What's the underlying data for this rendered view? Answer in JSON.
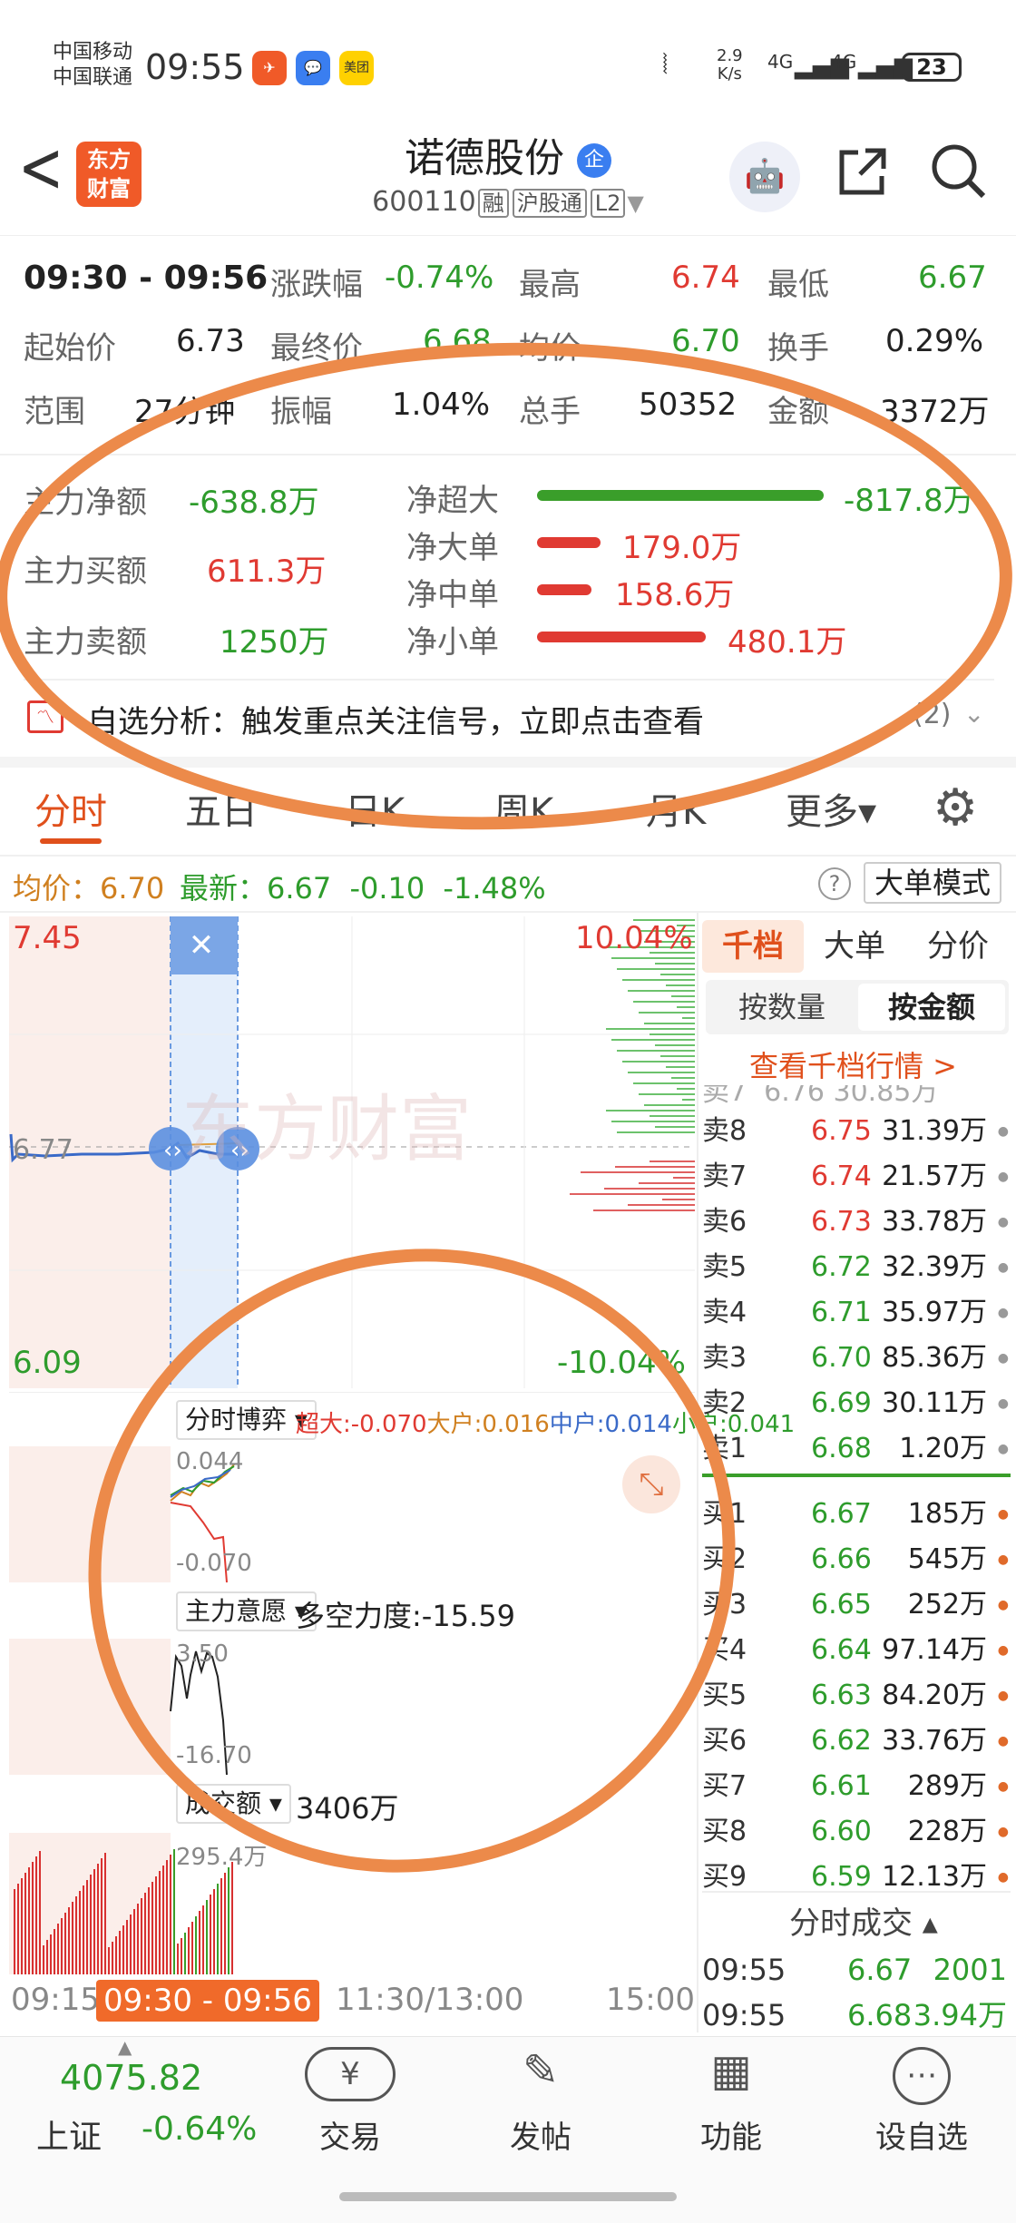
{
  "status": {
    "carrier1": "中国移动",
    "carrier2": "中国联通",
    "time": "09:55",
    "apps": [
      "✈",
      "💬",
      "美团"
    ],
    "net_speed": "2.9\nK/s",
    "sig1": "4G",
    "sig2": "4G",
    "battery": "23"
  },
  "header": {
    "back": "<",
    "logo": "东方\n财富",
    "title": "诺德股份",
    "badge": "企",
    "code": "600110",
    "tags": [
      "融",
      "沪股通",
      "L2"
    ]
  },
  "quote": {
    "time_range": "09:30 - 09:56",
    "row1": [
      {
        "label": "涨跌幅",
        "value": "-0.74%",
        "color": "#2e9c2c"
      },
      {
        "label": "最高",
        "value": "6.74",
        "color": "#e03a32"
      },
      {
        "label": "最低",
        "value": "6.67",
        "color": "#2e9c2c"
      }
    ],
    "row2": [
      {
        "label": "起始价",
        "value": "6.73",
        "color": "#222"
      },
      {
        "label": "最终价",
        "value": "6.68",
        "color": "#2e9c2c"
      },
      {
        "label": "均价",
        "value": "6.70",
        "color": "#2e9c2c"
      },
      {
        "label": "换手",
        "value": "0.29%",
        "color": "#222"
      }
    ],
    "row3": [
      {
        "label": "范围",
        "value": "27分钟",
        "color": "#222"
      },
      {
        "label": "振幅",
        "value": "1.04%",
        "color": "#222"
      },
      {
        "label": "总手",
        "value": "50352",
        "color": "#222"
      },
      {
        "label": "金额",
        "value": "3372万",
        "color": "#222"
      }
    ]
  },
  "fund_flow": {
    "left": [
      {
        "label": "主力净额",
        "value": "-638.8万",
        "color": "#2e9c2c"
      },
      {
        "label": "主力买额",
        "value": "611.3万",
        "color": "#e03a32"
      },
      {
        "label": "主力卖额",
        "value": "1250万",
        "color": "#2e9c2c"
      }
    ],
    "right": [
      {
        "label": "净超大",
        "value": "-817.8万",
        "color": "#2e9c2c",
        "fill": 1.0
      },
      {
        "label": "净大单",
        "value": "179.0万",
        "color": "#e03a32",
        "fill": 0.22
      },
      {
        "label": "净中单",
        "value": "158.6万",
        "color": "#e03a32",
        "fill": 0.19
      },
      {
        "label": "净小单",
        "value": "480.1万",
        "color": "#e03a32",
        "fill": 0.59
      }
    ],
    "alert": "自选分析：触发重点关注信号，立即点击查看",
    "alert_count": "(2)"
  },
  "tabs": [
    "分时",
    "五日",
    "日K",
    "周K",
    "月K",
    "更多▾"
  ],
  "chart_header": {
    "avg_label": "均价：6.70",
    "latest_label": "最新：",
    "latest": "6.67",
    "change": "-0.10",
    "change_pct": "-1.48%",
    "mode_button": "大单模式"
  },
  "chart": {
    "ymax": "7.45",
    "ymid": "6.77",
    "ymin": "6.09",
    "pct_top": "10.04%",
    "pct_bot": "-10.04%",
    "watermark": "东方财富",
    "close_x": "✕",
    "xt1": "09:15",
    "xt_sel": "09:30 - 09:56",
    "xt2": "11:30/13:00",
    "xt3": "15:00"
  },
  "sub1": {
    "label": "分时博弈",
    "super": "超大:-0.070",
    "big": "大户:0.016",
    "mid": "中户:0.014",
    "small": "小户:0.041",
    "top": "0.044",
    "bot": "-0.070"
  },
  "sub2": {
    "label": "主力意愿",
    "value": "多空力度:-15.59",
    "top": "3.50",
    "bot": "-16.70"
  },
  "sub3": {
    "label": "成交额",
    "value": "3406万",
    "top": "295.4万"
  },
  "orderbook": {
    "tabs": [
      "千档",
      "大单",
      "分价"
    ],
    "mode": [
      "按数量",
      "按金额"
    ],
    "link": "查看千档行情 >",
    "sells": [
      {
        "label": "卖8",
        "price": "6.75",
        "amt": "31.39万"
      },
      {
        "label": "卖7",
        "price": "6.74",
        "amt": "21.57万"
      },
      {
        "label": "卖6",
        "price": "6.73",
        "amt": "33.78万"
      },
      {
        "label": "卖5",
        "price": "6.72",
        "amt": "32.39万"
      },
      {
        "label": "卖4",
        "price": "6.71",
        "amt": "35.97万"
      },
      {
        "label": "卖3",
        "price": "6.70",
        "amt": "85.36万"
      },
      {
        "label": "卖2",
        "price": "6.69",
        "amt": "30.11万"
      },
      {
        "label": "卖1",
        "price": "6.68",
        "amt": "1.20万"
      }
    ],
    "buys": [
      {
        "label": "买1",
        "price": "6.67",
        "amt": "185万"
      },
      {
        "label": "买2",
        "price": "6.66",
        "amt": "545万"
      },
      {
        "label": "买3",
        "price": "6.65",
        "amt": "252万"
      },
      {
        "label": "买4",
        "price": "6.64",
        "amt": "97.14万"
      },
      {
        "label": "买5",
        "price": "6.63",
        "amt": "84.20万"
      },
      {
        "label": "买6",
        "price": "6.62",
        "amt": "33.76万"
      },
      {
        "label": "买7",
        "price": "6.61",
        "amt": "289万"
      },
      {
        "label": "买8",
        "price": "6.60",
        "amt": "228万"
      },
      {
        "label": "买9",
        "price": "6.59",
        "amt": "12.13万"
      }
    ],
    "trades_title": "分时成交 ▴",
    "trades": [
      {
        "time": "09:55",
        "price": "6.67",
        "vol": "2001"
      },
      {
        "time": "09:55",
        "price": "6.68",
        "vol": "3.94万"
      }
    ]
  },
  "nav": {
    "index_value": "4075.82",
    "index_name": "上证",
    "index_change": "-0.64%",
    "items": [
      {
        "icon": "¥",
        "label": "交易"
      },
      {
        "icon": "✎",
        "label": "发帖"
      },
      {
        "icon": "▦",
        "label": "功能"
      },
      {
        "icon": "⋯",
        "label": "设自选"
      }
    ]
  }
}
